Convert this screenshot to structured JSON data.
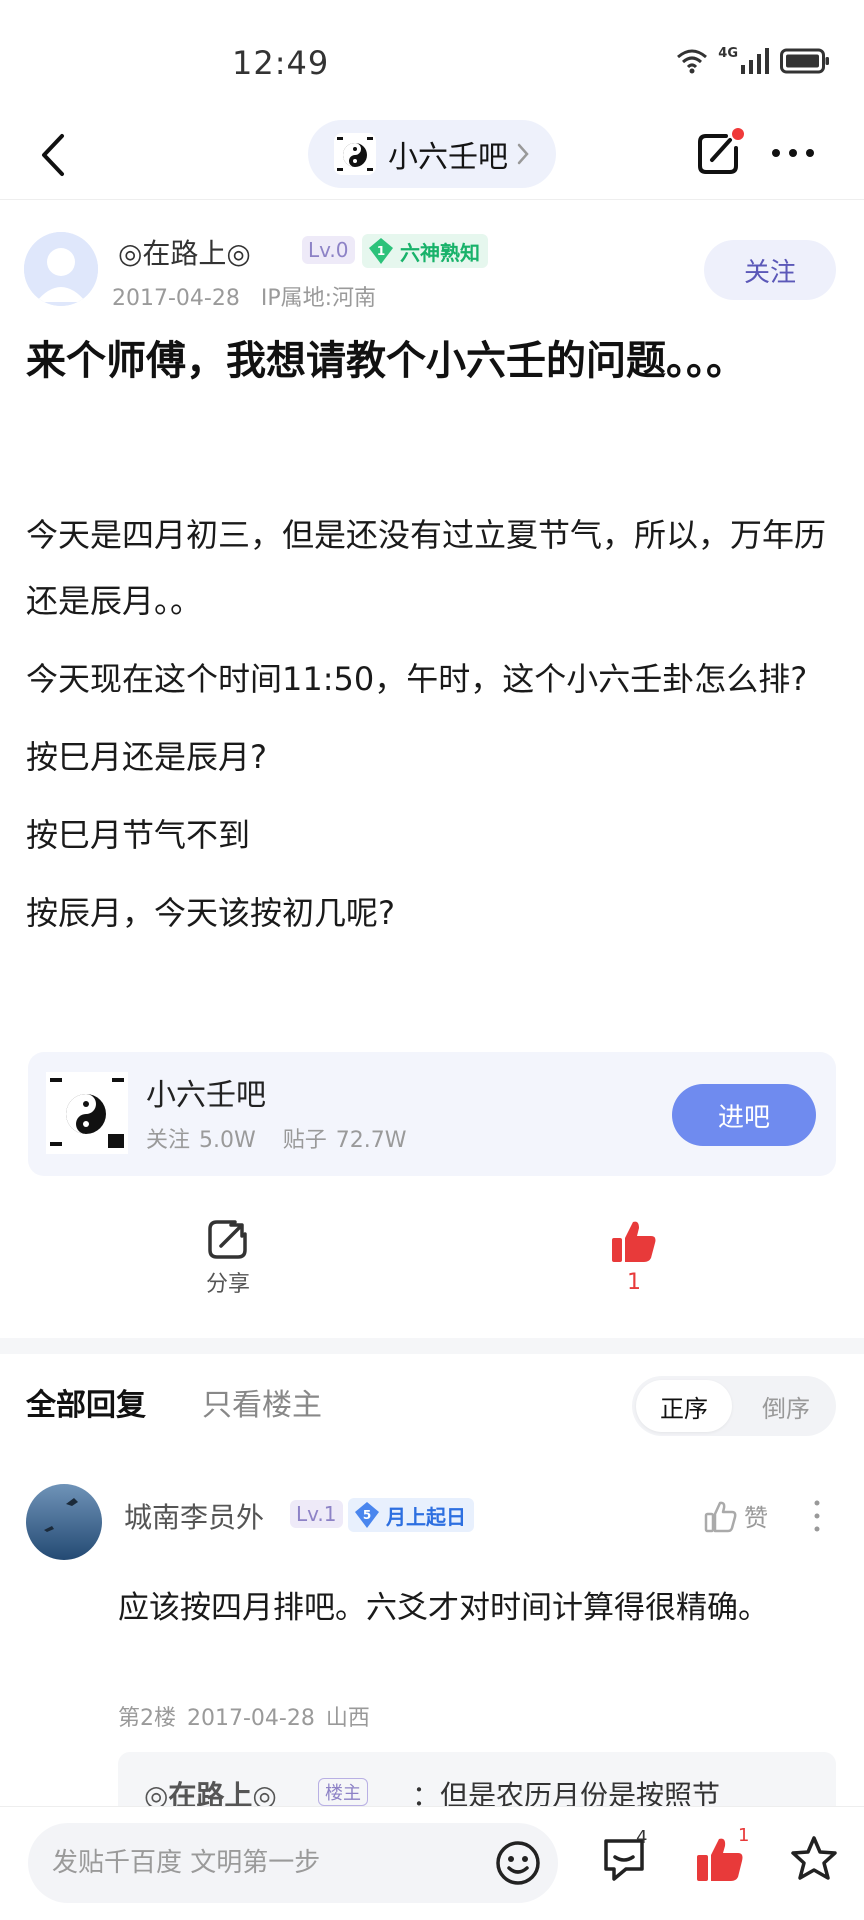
{
  "status_bar": {
    "time": "12:49",
    "network": "4G"
  },
  "nav": {
    "forum_name": "小六壬吧"
  },
  "post": {
    "author": {
      "name": "◎在路上◎",
      "level": "Lv.0",
      "title_level": "1",
      "title": "六神熟知",
      "date": "2017-04-28",
      "ip": "IP属地:河南"
    },
    "follow_label": "关注",
    "title": "来个师傅，我想请教个小六壬的问题。。。",
    "paragraphs": [
      "今天是四月初三，但是还没有过立夏节气，所以，万年历还是辰月。。",
      "今天现在这个时间11:50，午时，这个小六壬卦怎么排?",
      "按巳月还是辰月?",
      "按巳月节气不到",
      "按辰月，今天该按初几呢?"
    ]
  },
  "forum_card": {
    "name": "小六壬吧",
    "followers": "关注 5.0W",
    "posts": "贴子 72.7W",
    "enter_label": "进吧"
  },
  "actions": {
    "share_label": "分享",
    "like_count": "1"
  },
  "tabs": {
    "all": "全部回复",
    "owner_only": "只看楼主",
    "order_asc": "正序",
    "order_desc": "倒序"
  },
  "reply": {
    "name": "城南李员外",
    "level": "Lv.1",
    "title_level": "5",
    "title": "月上起日",
    "like_label": "赞",
    "text": "应该按四月排吧。六爻才对时间计算得很精确。",
    "floor": "第2楼",
    "date": "2017-04-28",
    "location": "山西",
    "sub_reply": {
      "name": "◎在路上◎",
      "tag": "楼主",
      "text": "：但是农历月份是按照节"
    }
  },
  "bottom_bar": {
    "placeholder": "发贴千百度 文明第一步",
    "comment_count": "4",
    "like_count": "1"
  },
  "colors": {
    "accent": "#6f8bef",
    "like_red": "#e83a3a",
    "level_purple": "#8d82c6",
    "title_green": "#18b26a"
  }
}
